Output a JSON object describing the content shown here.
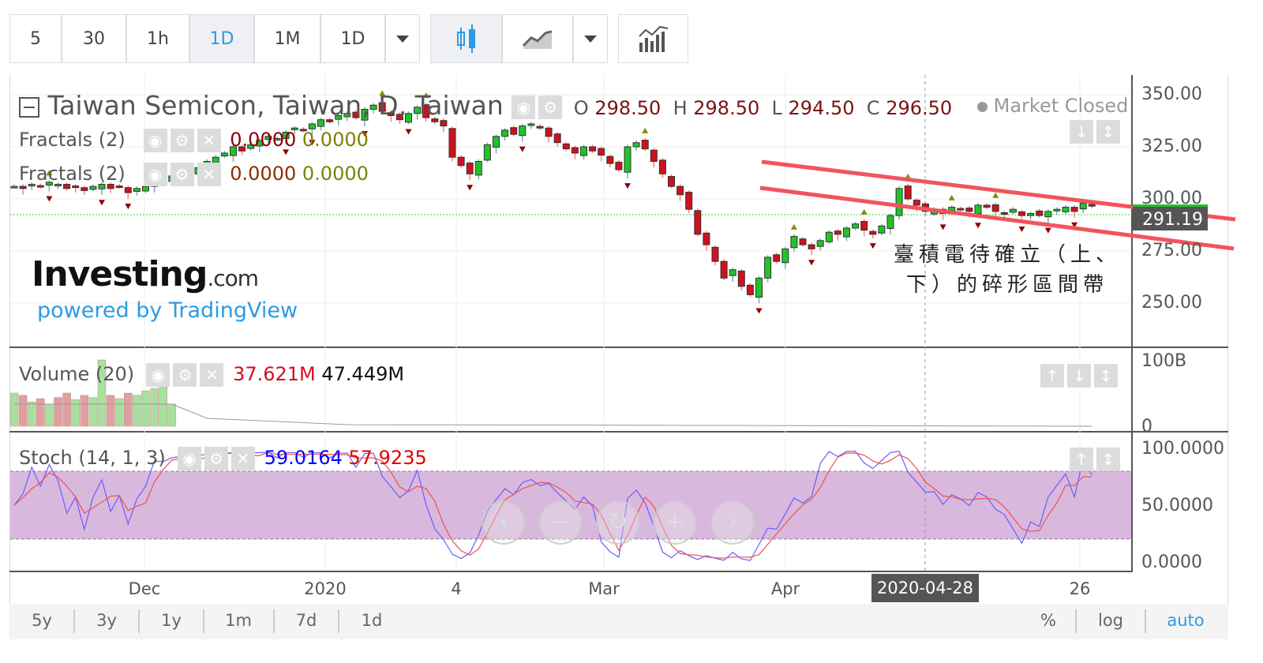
{
  "toolbar": {
    "intervals": [
      "5",
      "30",
      "1h",
      "1D",
      "1M",
      "1D"
    ],
    "active_interval": "1D"
  },
  "header": {
    "symbol_title": "Taiwan Semicon, Taiwan, D, Taiwan",
    "o_label": "O",
    "o": "298.50",
    "h_label": "H",
    "h": "298.50",
    "l_label": "L",
    "l": "294.50",
    "c_label": "C",
    "c": "296.50",
    "market_status": "Market Closed"
  },
  "indicators": [
    {
      "name": "Fractals (2)",
      "v1": "0.0000",
      "v2": "0.0000"
    },
    {
      "name": "Fractals (2)",
      "v1": "0.0000",
      "v2": "0.0000"
    }
  ],
  "volume": {
    "name": "Volume (20)",
    "v1": "37.621M",
    "v2": "47.449M",
    "axis": [
      "100B",
      "0"
    ]
  },
  "stoch": {
    "name": "Stoch (14, 1, 3)",
    "k": "59.0164",
    "d": "57.9235",
    "axis": [
      "100.0000",
      "50.0000",
      "0.0000"
    ]
  },
  "price_axis": [
    "350.00",
    "325.00",
    "300.00",
    "275.00",
    "250.00"
  ],
  "last_price": "291.19",
  "annotation": [
    "臺積電待確立（上、",
    "下）的碎形區間帶"
  ],
  "watermark": {
    "brand": "Investing",
    "brand_suffix": ".com",
    "powered": "powered by TradingView"
  },
  "x_axis": [
    "Dec",
    "2020",
    "4",
    "Mar",
    "Apr",
    "26"
  ],
  "crosshair_date": "2020-04-28",
  "ranges": [
    "5y",
    "3y",
    "1y",
    "1m",
    "7d",
    "1d"
  ],
  "scale_options": [
    "%",
    "log",
    "auto"
  ],
  "colors": {
    "up": "#22c32a",
    "down": "#d0111b",
    "accent": "#2c9be6",
    "trend": "#f2545b"
  },
  "chart_data": {
    "type": "candlestick",
    "closes": [
      306,
      305,
      307,
      306,
      308,
      307,
      305,
      306,
      304,
      306,
      307,
      305,
      306,
      303,
      305,
      306,
      308,
      309,
      311,
      313,
      312,
      315,
      318,
      320,
      322,
      325,
      323,
      326,
      328,
      330,
      329,
      332,
      334,
      333,
      336,
      338,
      337,
      340,
      341,
      339,
      343,
      345,
      342,
      340,
      338,
      341,
      344,
      339,
      337,
      335,
      320,
      316,
      312,
      318,
      326,
      330,
      333,
      331,
      335,
      336,
      334,
      330,
      327,
      324,
      322,
      325,
      323,
      321,
      317,
      314,
      325,
      327,
      324,
      318,
      312,
      306,
      302,
      295,
      283,
      278,
      270,
      262,
      266,
      258,
      254,
      262,
      272,
      270,
      276,
      282,
      278,
      276,
      280,
      284,
      283,
      286,
      288,
      285,
      283,
      287,
      292,
      305,
      300,
      297,
      294,
      295,
      293,
      296,
      295,
      294,
      297,
      296,
      294,
      293,
      295,
      292,
      293,
      292,
      294,
      295,
      296,
      294,
      298,
      296.5
    ],
    "volumes": [
      30,
      28,
      22,
      25,
      20,
      26,
      30,
      24,
      28,
      26,
      60,
      28,
      25,
      30,
      28,
      32,
      34,
      36,
      20
    ],
    "ylim": [
      240,
      355
    ]
  }
}
